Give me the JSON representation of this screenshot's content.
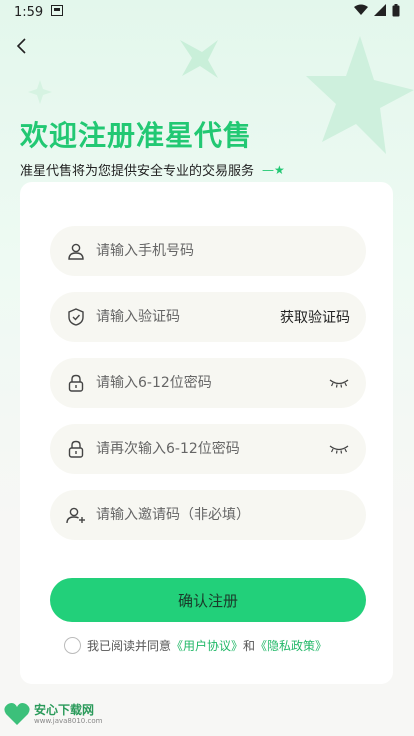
{
  "status_bar": {
    "time": "1:59"
  },
  "header": {
    "title": "欢迎注册准星代售",
    "subtitle": "准星代售将为您提供安全专业的交易服务"
  },
  "form": {
    "phone_placeholder": "请输入手机号码",
    "code_placeholder": "请输入验证码",
    "get_code_label": "获取验证码",
    "password_placeholder": "请输入6-12位密码",
    "confirm_password_placeholder": "请再次输入6-12位密码",
    "invite_placeholder": "请输入邀请码（非必填）",
    "submit_label": "确认注册"
  },
  "agreement": {
    "prefix": "我已阅读并同意",
    "user_agreement": "《用户协议》",
    "and": "和",
    "privacy_policy": "《隐私政策》"
  },
  "watermark": {
    "title": "安心下载网",
    "url": "www.java8010.com"
  },
  "colors": {
    "accent": "#22d07a",
    "title": "#22c873",
    "link": "#22b868"
  }
}
